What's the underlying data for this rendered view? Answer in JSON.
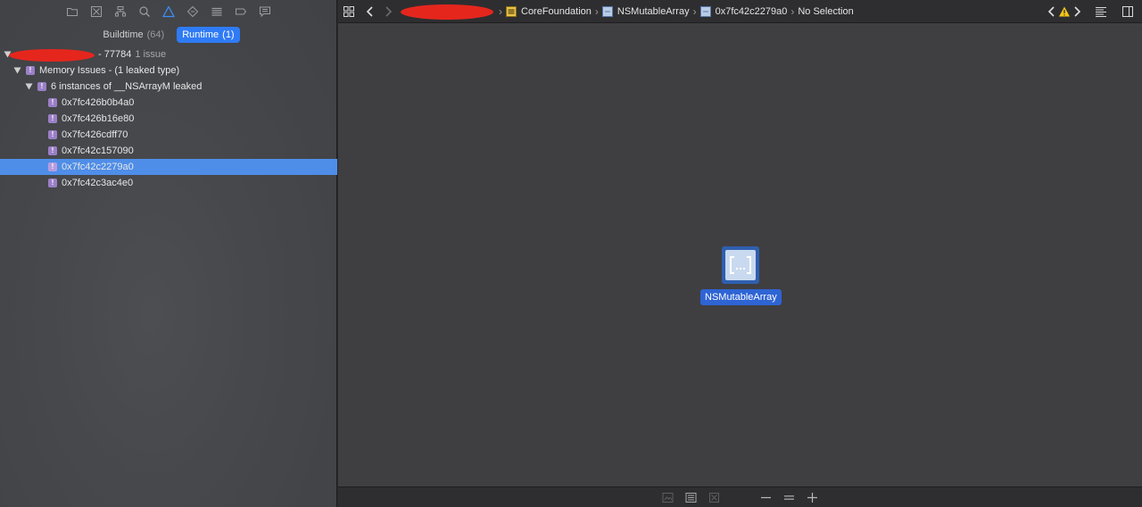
{
  "navigator": {
    "toolbar_icons": [
      "folder-icon",
      "source-control-icon",
      "hierarchy-icon",
      "find-icon",
      "issue-warning-icon",
      "test-diamond-icon",
      "debug-icon",
      "breakpoint-icon",
      "report-icon"
    ],
    "active_icon": "issue-warning-icon",
    "scope": [
      {
        "label": "Buildtime",
        "count": "(64)",
        "active": false
      },
      {
        "label": "Runtime",
        "count": "(1)",
        "active": true
      }
    ],
    "tree": {
      "process": {
        "name": "- 77784",
        "issue_count": "1 issue"
      },
      "category": {
        "label": "Memory Issues - (1 leaked type)"
      },
      "group": {
        "label": "6 instances of __NSArrayM leaked"
      },
      "instances": [
        {
          "address": "0x7fc426b0b4a0",
          "selected": false
        },
        {
          "address": "0x7fc426b16e80",
          "selected": false
        },
        {
          "address": "0x7fc426cdff70",
          "selected": false
        },
        {
          "address": "0x7fc42c157090",
          "selected": false
        },
        {
          "address": "0x7fc42c2279a0",
          "selected": true
        },
        {
          "address": "0x7fc42c3ac4e0",
          "selected": false
        }
      ]
    }
  },
  "jump_bar": {
    "crumbs": [
      "CoreFoundation",
      "NSMutableArray",
      "0x7fc42c2279a0",
      "No Selection"
    ],
    "crumb_icons": [
      "framework-icon",
      "class-icon",
      "object-icon",
      ""
    ]
  },
  "graph": {
    "node_label": "NSMutableArray",
    "node_icon": "array-brackets-icon"
  },
  "colors": {
    "selection": "#4f8ee8",
    "accent": "#2f7bf5",
    "issue_badge": "#9b7fc6",
    "warning": "#f5c518"
  }
}
